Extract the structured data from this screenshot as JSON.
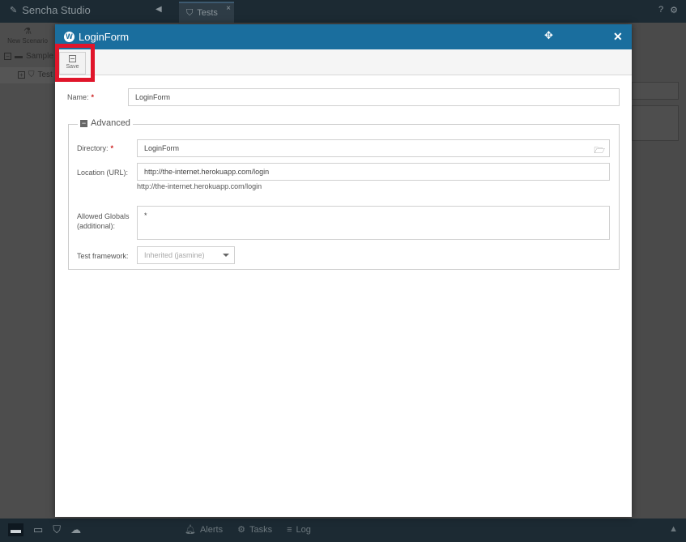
{
  "app": {
    "title": "Sencha Studio",
    "tab_label": "Tests",
    "new_scenario_label": "New Scenario",
    "tree_item_1": "Sample",
    "tree_item_2": "Test",
    "bottom_tabs": [
      "Alerts",
      "Tasks",
      "Log"
    ]
  },
  "modal": {
    "title": "LoginForm",
    "icon_letter": "W",
    "toolbar": {
      "save_label": "Save"
    },
    "fields": {
      "name": {
        "label": "Name:",
        "value": "LoginForm"
      },
      "directory": {
        "label": "Directory:",
        "value": "LoginForm"
      },
      "location": {
        "label": "Location (URL):",
        "value": "http://the-internet.herokuapp.com/login",
        "display": "http://the-internet.herokuapp.com/login"
      },
      "allowed_globals": {
        "label_line1": "Allowed Globals",
        "label_line2": "(additional):",
        "value": "*"
      },
      "test_framework": {
        "label": "Test framework:",
        "value": "Inherited (jasmine)"
      }
    },
    "advanced_section_label": "Advanced"
  },
  "colors": {
    "header": "#1a6e9e",
    "highlight": "#e0152a",
    "required": "#cc1e1e"
  }
}
